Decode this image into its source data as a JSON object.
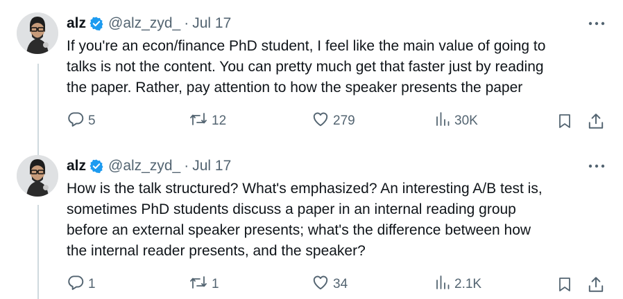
{
  "tweets": [
    {
      "display_name": "alz",
      "handle": "@alz_zyd_",
      "separator": "·",
      "date": "Jul 17",
      "text": "If you're an econ/finance PhD student, I feel like the main value of going to\ntalks is not the content. You can pretty much get that faster just by reading\nthe paper. Rather, pay attention to how the speaker presents the paper",
      "replies": "5",
      "reposts": "12",
      "likes": "279",
      "views": "30K"
    },
    {
      "display_name": "alz",
      "handle": "@alz_zyd_",
      "separator": "·",
      "date": "Jul 17",
      "text": "How is the talk structured? What's emphasized? An interesting A/B test is,\nsometimes PhD students discuss a paper in an internal reading group\nbefore an external speaker presents; what's the difference between how\nthe internal reader presents, and the speaker?",
      "replies": "1",
      "reposts": "1",
      "likes": "34",
      "views": "2.1K"
    }
  ],
  "icons": {
    "verified": "verified-badge-icon",
    "more": "more-icon",
    "reply": "reply-icon",
    "repost": "repost-icon",
    "like": "like-icon",
    "views": "views-icon",
    "bookmark": "bookmark-icon",
    "share": "share-icon"
  },
  "colors": {
    "text": "#0f1419",
    "secondary": "#536471",
    "verified": "#1d9bf0",
    "thread_line": "#cfd9de"
  }
}
